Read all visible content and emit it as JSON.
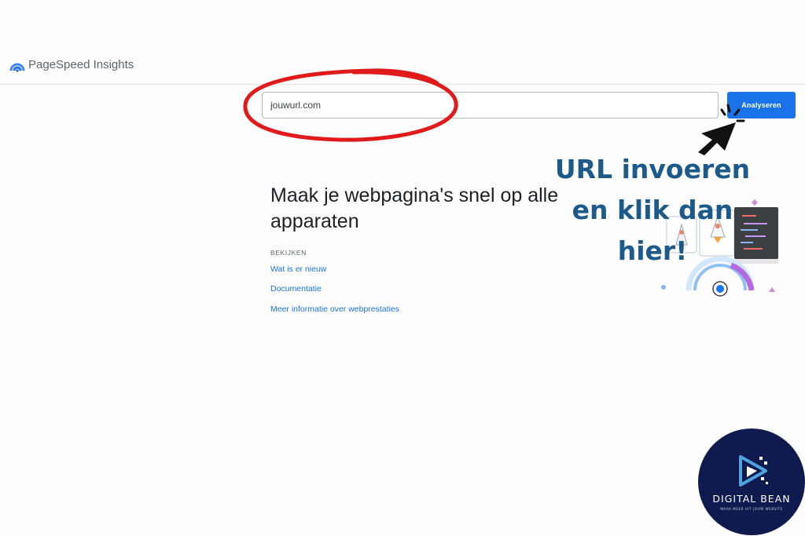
{
  "app": {
    "name": "PageSpeed Insights",
    "icon": "pagespeed-gauge-icon"
  },
  "search": {
    "value": "jouwurl.com",
    "button_label": "Analyseren"
  },
  "main": {
    "headline": "Maak je webpagina's snel op alle apparaten",
    "section_label": "BEKIJKEN",
    "links": [
      "Wat is er nieuw",
      "Documentatie",
      "Meer informatie over webprestaties"
    ]
  },
  "overlay": {
    "callout_lines": [
      "URL invoeren",
      "en klik dan",
      "hier!"
    ],
    "annotation_color": "#e11b1b",
    "callout_color": "#1d5a8c",
    "cursor_icon": "click-cursor-icon"
  },
  "logo": {
    "name": "DIGITAL BEAN",
    "tagline": "MAAK MEER UIT JOUW WEBSITE",
    "background_color": "#0f1b4e"
  },
  "colors": {
    "accent": "#1a73e8",
    "link": "#1a73e8"
  }
}
